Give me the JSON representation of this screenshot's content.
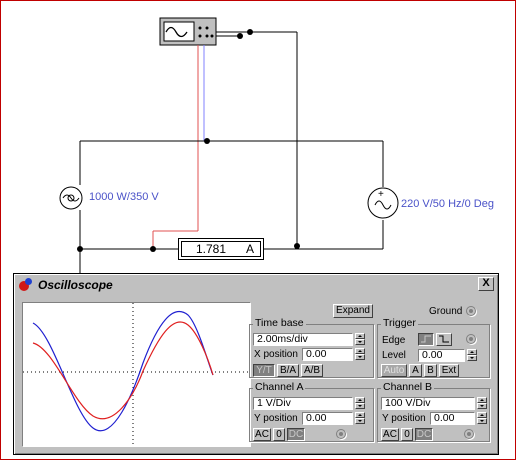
{
  "lamp": {
    "label": "1000 W/350 V"
  },
  "source": {
    "label": "220 V/50 Hz/0 Deg"
  },
  "ammeter": {
    "value": "1.781",
    "unit": "A"
  },
  "oscilloscope": {
    "title": "Oscilloscope",
    "close_label": "X",
    "expand_label": "Expand",
    "ground_label": "Ground",
    "timebase": {
      "title": "Time base",
      "value": "2.00ms/div",
      "xpos_label": "X position",
      "xpos_value": "0.00",
      "modes": [
        "Y/T",
        "B/A",
        "A/B"
      ]
    },
    "trigger": {
      "title": "Trigger",
      "edge_label": "Edge",
      "level_label": "Level",
      "level_value": "0.00",
      "sources": [
        "Auto",
        "A",
        "B",
        "Ext"
      ]
    },
    "channel_a": {
      "title": "Channel A",
      "value": "1  V/Div",
      "ypos_label": "Y position",
      "ypos_value": "0.00",
      "coupling": [
        "AC",
        "0",
        "DC"
      ]
    },
    "channel_b": {
      "title": "Channel B",
      "value": "100  V/Div",
      "ypos_label": "Y position",
      "ypos_value": "0.00",
      "coupling": [
        "AC",
        "0",
        "DC"
      ]
    }
  },
  "colors": {
    "wire": "#000000",
    "probe_a": "#e05050",
    "probe_b": "#8080ff",
    "trace_a": "#e02020",
    "trace_b": "#2020d0"
  }
}
